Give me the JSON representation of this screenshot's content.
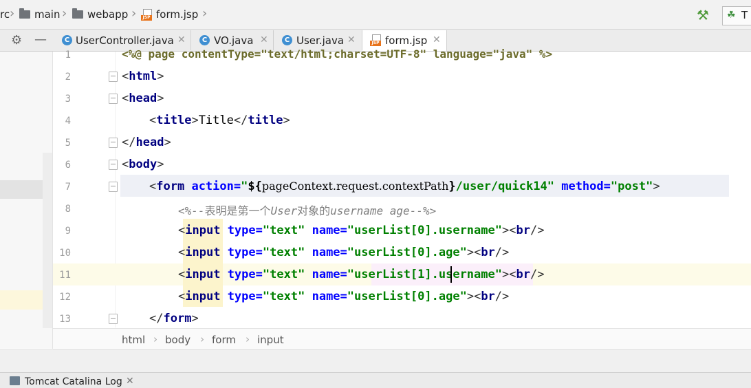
{
  "breadcrumbs": {
    "root": "rc",
    "main": "main",
    "webapp": "webapp",
    "file": "form.jsp"
  },
  "toolbar": {
    "run_label": "T"
  },
  "tabs": [
    {
      "label": "UserController.java",
      "icon": "C"
    },
    {
      "label": "VO.java",
      "icon": "C"
    },
    {
      "label": "User.java",
      "icon": "C"
    },
    {
      "label": "form.jsp",
      "icon": "JSP",
      "active": true
    }
  ],
  "editor": {
    "line_numbers": [
      "1",
      "2",
      "3",
      "4",
      "5",
      "6",
      "7",
      "8",
      "9",
      "10",
      "11",
      "12",
      "13"
    ],
    "line1": "<%@ page contentType=\"text/html;charset=UTF-8\" language=\"java\" %>",
    "html_tag": "html",
    "head_tag": "head",
    "title_tag": "title",
    "title_text": "Title",
    "body_tag": "body",
    "form_tag": "form",
    "form_action_attr": "action",
    "form_action_expr": "pageContext.request.contextPath",
    "form_action_path": "/user/quick14",
    "form_method_attr": "method",
    "form_method_val": "post",
    "comment_open": "<%--",
    "comment_cn1": "表明是第一个",
    "comment_en1": "User",
    "comment_cn2": "对象的",
    "comment_en2": "username age",
    "comment_close": "--%>",
    "input_tag": "input",
    "br_tag": "br",
    "type_attr": "type",
    "name_attr": "name",
    "type_val": "text",
    "inputs": [
      "userList[0].username",
      "userList[0].age",
      "userList[1].username",
      "userList[0].age"
    ]
  },
  "path_bar": [
    "html",
    "body",
    "form",
    "input"
  ],
  "bottom_tab": {
    "label": "Tomcat Catalina Log"
  }
}
